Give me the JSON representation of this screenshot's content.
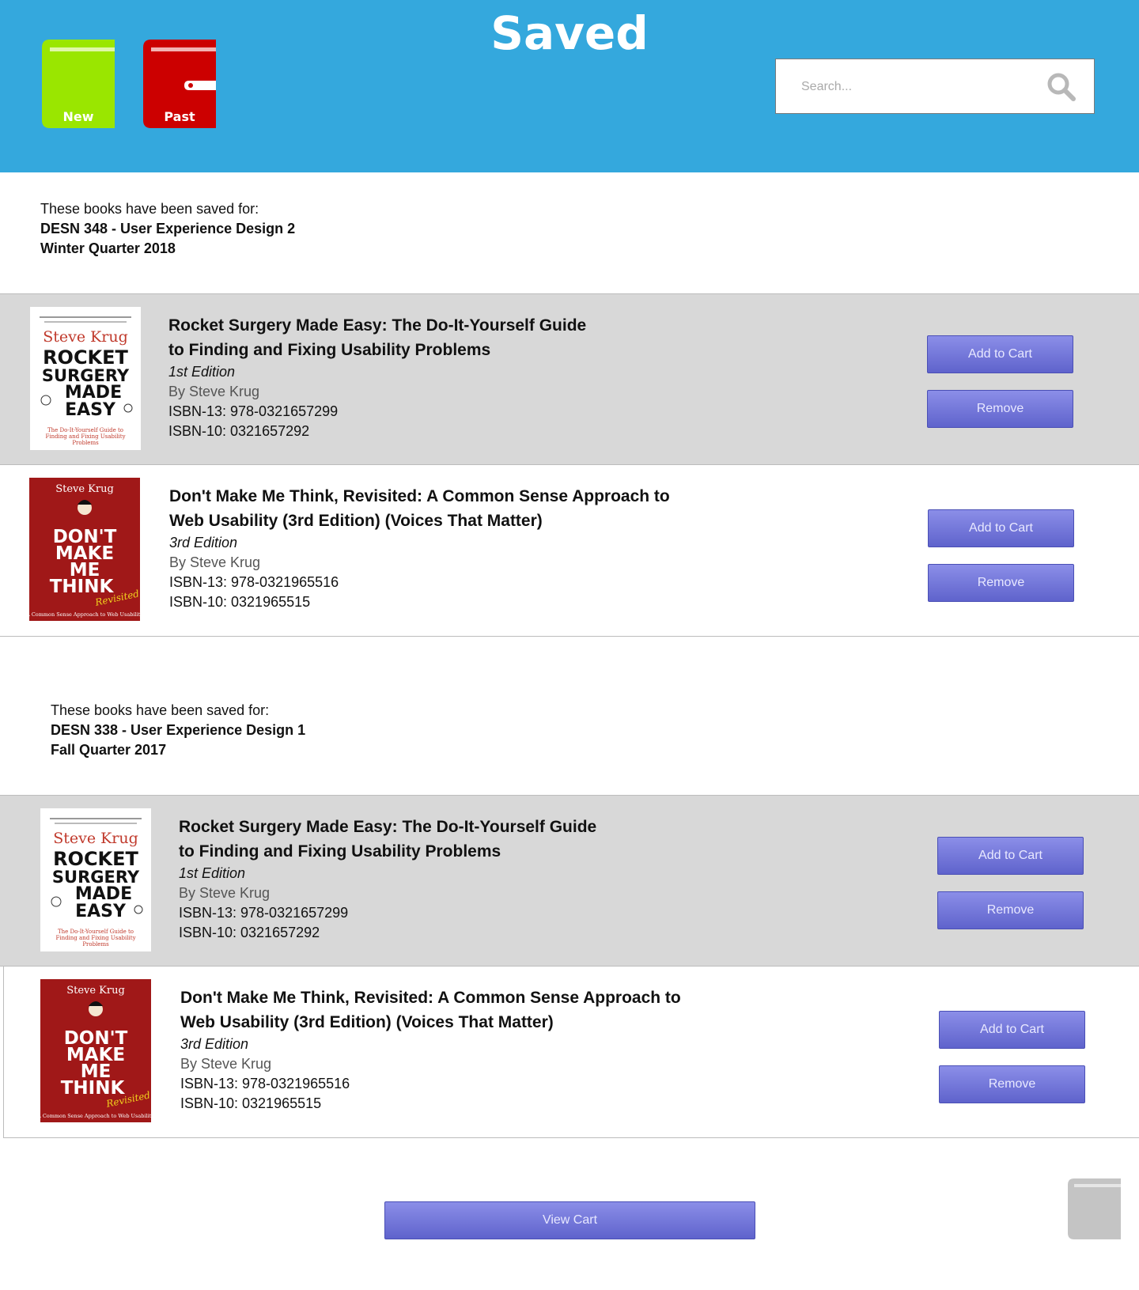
{
  "header": {
    "title": "Saved",
    "new_label": "New",
    "past_label": "Past",
    "search_placeholder": "Search..."
  },
  "sections": [
    {
      "intro": "These books have been saved for:",
      "course": "DESN 348 - User Experience Design 2",
      "term": "Winter Quarter 2018",
      "books": [
        {
          "cover": {
            "author": "Steve Krug",
            "lines": [
              "ROCKET",
              "SURGERY",
              "MADE",
              "EASY"
            ],
            "subtitle": "The Do-It-Yourself Guide to Finding and Fixing Usability Problems"
          },
          "title_line1": "Rocket Surgery Made Easy: The Do-It-Yourself Guide",
          "title_line2": "to Finding and Fixing Usability Problems",
          "edition": "1st Edition",
          "author": "By Steve Krug",
          "isbn13": "ISBN-13: 978-0321657299",
          "isbn10": "ISBN-10: 0321657292",
          "add_label": "Add to Cart",
          "remove_label": "Remove"
        },
        {
          "cover": {
            "author": "Steve Krug",
            "lines": [
              "DON'T",
              "MAKE",
              "ME",
              "THINK"
            ],
            "accent": "Revisited",
            "subtitle": "A Common Sense Approach to Web Usability"
          },
          "title_line1": "Don't Make Me Think, Revisited: A Common Sense Approach to",
          "title_line2": "Web Usability (3rd Edition) (Voices That Matter)",
          "edition": "3rd Edition",
          "author": "By Steve Krug",
          "isbn13": "ISBN-13: 978-0321965516",
          "isbn10": "ISBN-10: 0321965515",
          "add_label": "Add to Cart",
          "remove_label": "Remove"
        }
      ]
    },
    {
      "intro": "These books have been saved for:",
      "course": "DESN 338 - User Experience Design 1",
      "term": "Fall Quarter 2017",
      "books": [
        {
          "cover": {
            "author": "Steve Krug",
            "lines": [
              "ROCKET",
              "SURGERY",
              "MADE",
              "EASY"
            ],
            "subtitle": "The Do-It-Yourself Guide to Finding and Fixing Usability Problems"
          },
          "title_line1": "Rocket Surgery Made Easy: The Do-It-Yourself Guide",
          "title_line2": "to Finding and Fixing Usability Problems",
          "edition": "1st Edition",
          "author": "By Steve Krug",
          "isbn13": "ISBN-13: 978-0321657299",
          "isbn10": "ISBN-10: 0321657292",
          "add_label": "Add to Cart",
          "remove_label": "Remove"
        },
        {
          "cover": {
            "author": "Steve Krug",
            "lines": [
              "DON'T",
              "MAKE",
              "ME",
              "THINK"
            ],
            "accent": "Revisited",
            "subtitle": "A Common Sense Approach to Web Usability"
          },
          "title_line1": "Don't Make Me Think, Revisited: A Common Sense Approach to",
          "title_line2": "Web Usability (3rd Edition) (Voices That Matter)",
          "edition": "3rd Edition",
          "author": "By Steve Krug",
          "isbn13": "ISBN-13: 978-0321965516",
          "isbn10": "ISBN-10: 0321965515",
          "add_label": "Add to Cart",
          "remove_label": "Remove"
        }
      ]
    }
  ],
  "footer": {
    "view_cart_label": "View Cart"
  },
  "colors": {
    "header_bg": "#34a8dd",
    "new_book": "#9ae600",
    "past_book": "#cc0000",
    "button": "#6d71d6",
    "row_gray": "#d8d8d8"
  }
}
